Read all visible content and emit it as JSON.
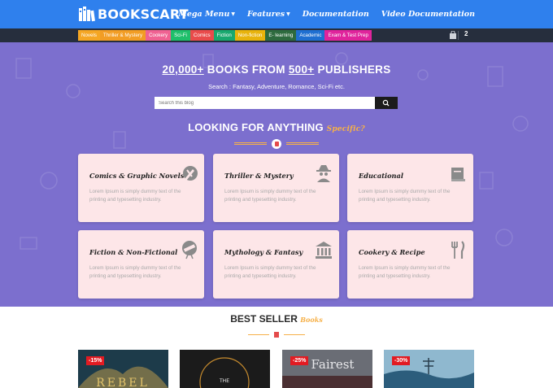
{
  "brand": {
    "name": "BOOKSCART"
  },
  "nav": [
    {
      "label": "Mega Menu",
      "caret": true
    },
    {
      "label": "Features",
      "caret": true
    },
    {
      "label": "Documentation",
      "caret": false
    },
    {
      "label": "Video Documentation",
      "caret": false
    }
  ],
  "categories": [
    {
      "label": "Novels",
      "color": "#f5a623"
    },
    {
      "label": "Thriller & Mystery",
      "color": "#f29d24"
    },
    {
      "label": "Cookery",
      "color": "#f06292"
    },
    {
      "label": "Sci-Fi",
      "color": "#1fbf6b"
    },
    {
      "label": "Comics",
      "color": "#e94b4b"
    },
    {
      "label": "Fiction",
      "color": "#18a86e"
    },
    {
      "label": "Non-fiction",
      "color": "#e8b30c"
    },
    {
      "label": "E- learning",
      "color": "#2d6a3e"
    },
    {
      "label": "Academic",
      "color": "#1f6fd1"
    },
    {
      "label": "Exam & Test Prep",
      "color": "#e0249c"
    }
  ],
  "cart": {
    "count": "2",
    "icon": "shopping-bag-icon"
  },
  "hero": {
    "title_part1": "20,000+",
    "title_part2": " BOOKS FROM ",
    "title_part3": "500+",
    "title_part4": " PUBLISHERS",
    "subtitle": "Search : Fantasy, Adventure, Romance, Sci-Fi etc.",
    "search_placeholder": "Search this blog",
    "looking_main": "LOOKING FOR ANYTHING ",
    "looking_accent": "Specific?"
  },
  "cards": [
    {
      "title": "Comics & Graphic Novels",
      "desc": "Lorem Ipsum is simply dummy text of the printing and typesetting industry.",
      "icon": "pen-brush-icon"
    },
    {
      "title": "Thriller & Mystery",
      "desc": "Lorem Ipsum is simply dummy text of the printing and typesetting industry.",
      "icon": "detective-icon"
    },
    {
      "title": "Educational",
      "desc": "Lorem Ipsum is simply dummy text of the printing and typesetting industry.",
      "icon": "book-icon"
    },
    {
      "title": "Fiction & Non-Fictional",
      "desc": "Lorem Ipsum is simply dummy text of the printing and typesetting industry.",
      "icon": "telescope-icon"
    },
    {
      "title": "Mythology & Fantasy",
      "desc": "Lorem Ipsum is simply dummy text of the printing and typesetting industry.",
      "icon": "temple-icon"
    },
    {
      "title": "Cookery & Recipe",
      "desc": "Lorem Ipsum is simply dummy text of the printing and typesetting industry.",
      "icon": "fork-knife-icon"
    }
  ],
  "best_seller": {
    "title": "BEST SELLER ",
    "accent": "Books"
  },
  "books": [
    {
      "badge": "-15%",
      "cover_text": "REBEL",
      "bg": "#1d3b4a"
    },
    {
      "badge": "",
      "cover_text": "THE",
      "bg": "#1b1b1b"
    },
    {
      "badge": "-25%",
      "cover_text": "Fairest",
      "bg": "#3f3f46"
    },
    {
      "badge": "-30%",
      "cover_text": "",
      "bg": "#5b8fb0"
    }
  ]
}
